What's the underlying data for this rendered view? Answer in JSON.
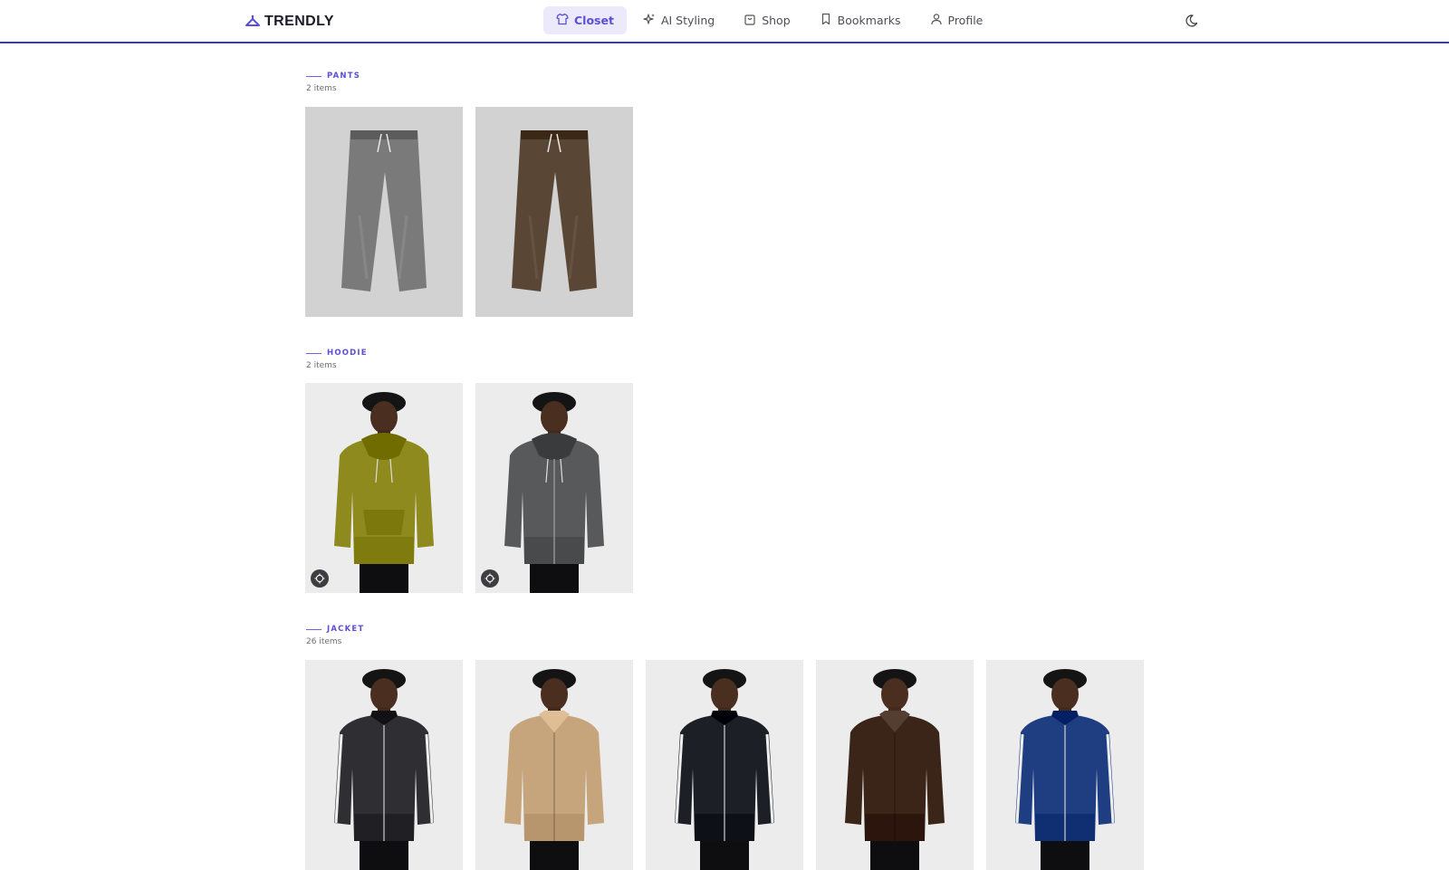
{
  "brand": {
    "name": "TRENDLY",
    "icon": "hanger-icon"
  },
  "nav": [
    {
      "label": "Closet",
      "icon": "shirt-icon",
      "active": true
    },
    {
      "label": "AI Styling",
      "icon": "sparkles-icon",
      "active": false
    },
    {
      "label": "Shop",
      "icon": "shopping-bag-icon",
      "active": false
    },
    {
      "label": "Bookmarks",
      "icon": "bookmark-icon",
      "active": false
    },
    {
      "label": "Profile",
      "icon": "user-icon",
      "active": false
    }
  ],
  "theme_toggle": {
    "icon": "moon-icon"
  },
  "accent_color": "#5b4fd6",
  "sections": [
    {
      "label": "PANTS",
      "count": "2 items",
      "items": [
        {
          "kind": "pants",
          "color": "#7a7a7a",
          "badge": false
        },
        {
          "kind": "pants",
          "color": "#5a4634",
          "badge": false
        }
      ]
    },
    {
      "label": "HOODIE",
      "count": "2 items",
      "items": [
        {
          "kind": "hoodie",
          "color": "#8f8a1e",
          "badge": true
        },
        {
          "kind": "zip-hoodie",
          "color": "#58595b",
          "badge": true
        }
      ]
    },
    {
      "label": "JACKET",
      "count": "26 items",
      "items": [
        {
          "kind": "track-jacket",
          "color": "#2e2e33",
          "badge": false
        },
        {
          "kind": "jacket",
          "color": "#c6a57d",
          "badge": false
        },
        {
          "kind": "track-jacket",
          "color": "#1d1f26",
          "badge": false
        },
        {
          "kind": "jacket",
          "color": "#3b2418",
          "badge": false
        },
        {
          "kind": "track-jacket",
          "color": "#1f3e82",
          "badge": false
        }
      ]
    }
  ]
}
